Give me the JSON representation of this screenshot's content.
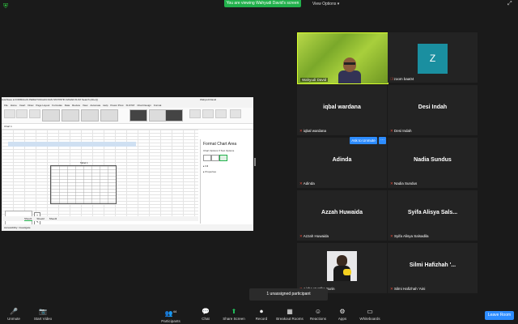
{
  "top": {
    "banner": "You are viewing Wahyudi David's screen",
    "view_options": "View Options ▾"
  },
  "excel": {
    "title": "AutoSave  ●  FORMULAS PERHITUNGAN DAN STATISTIK DASAR.XLSX   Search (Alt+Q)",
    "user": "Wahyudi David",
    "tabs": [
      "File",
      "Home",
      "Insert",
      "Draw",
      "Page Layout",
      "Formulas",
      "Data",
      "Review",
      "View",
      "Automate",
      "Help",
      "Power Pivot",
      "XLSTAT",
      "Chart Design",
      "Format"
    ],
    "name_box": "Chart 1",
    "table_title": "Tabel 1",
    "sheets": [
      "Sheet1",
      "Sheet2",
      "Sheet3"
    ],
    "status": "Accessibility: Investigate",
    "format_pane": {
      "title": "Format Chart Area",
      "options": "Chart Options ▾  Text Options",
      "fill": "▸ Fill",
      "properties": "▸ Properties"
    }
  },
  "participants": [
    {
      "id": "t1",
      "name": "Wahyudi David"
    },
    {
      "id": "t2",
      "name": "zoom baa04",
      "avatar_letter": "Z"
    },
    {
      "id": "t3",
      "name": "iqbal wardana",
      "display": "iqbal wardana"
    },
    {
      "id": "t4",
      "name": "Desi Indah",
      "display": "Desi Indah"
    },
    {
      "id": "t5",
      "name": "Adinda",
      "display": "Adinda"
    },
    {
      "id": "t6",
      "name": "Nadia Sundus",
      "display": "Nadia Sundus"
    },
    {
      "id": "t7",
      "name": "Azzah Huwaida",
      "display": "Azzah Huwaida"
    },
    {
      "id": "t8",
      "name": "Syifa Alisya Salsadila",
      "display": "Syifa Alisya Sals..."
    },
    {
      "id": "t9",
      "name": "Aisha Yustika Surin"
    },
    {
      "id": "t10",
      "name": "Silmi Hafizhah 'Aini",
      "display": "Silmi Hafizhah '..."
    }
  ],
  "ask_to_unmute": "Ask to Unmute",
  "more": "···",
  "unassigned": "1 unassigned participant",
  "toolbar": {
    "unmute": "Unmute",
    "start_video": "Start Video",
    "participants": "Participants",
    "participants_count": "44",
    "chat": "Chat",
    "share_screen": "Share Screen",
    "record": "Record",
    "breakout": "Breakout Rooms",
    "reactions": "Reactions",
    "apps": "Apps",
    "whiteboards": "Whiteboards",
    "leave": "Leave Room"
  },
  "colors": {
    "accent": "#2d8cff",
    "share_green": "#22b14c",
    "speaker_border": "#d8ff2e",
    "mute_red": "#e74c3c"
  }
}
